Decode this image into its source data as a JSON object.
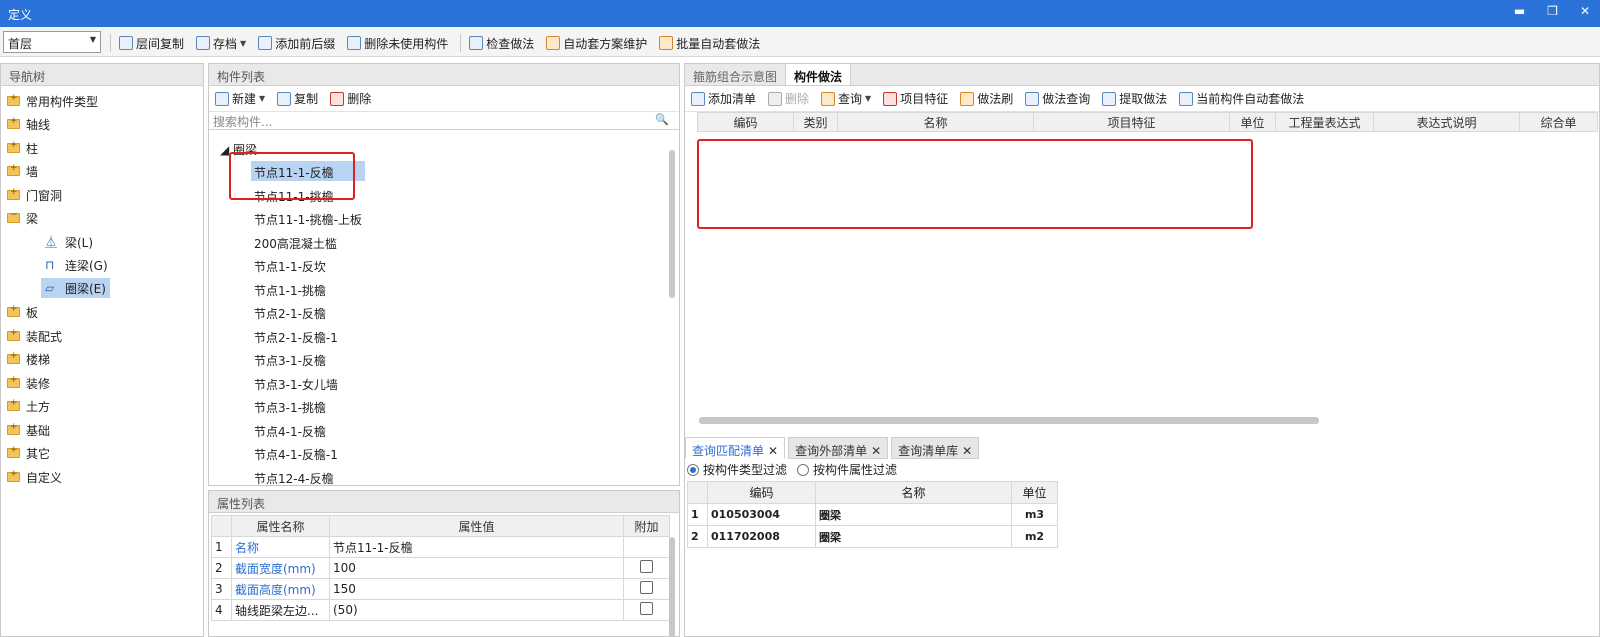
{
  "window": {
    "title": "定义",
    "minimize": "▬",
    "restore": "❐",
    "close": "✕"
  },
  "toolbar": {
    "floor_value": "首层",
    "items": [
      "层间复制",
      "存档",
      "添加前后缀",
      "删除未使用构件",
      "检查做法",
      "自动套方案维护",
      "批量自动套做法"
    ]
  },
  "nav": {
    "title": "导航树",
    "items": [
      "常用构件类型",
      "轴线",
      "柱",
      "墙",
      "门窗洞",
      "梁",
      "板",
      "装配式",
      "楼梯",
      "装修",
      "土方",
      "基础",
      "其它",
      "自定义"
    ],
    "sub_items": [
      "梁(L)",
      "连梁(G)",
      "圈梁(E)"
    ]
  },
  "components": {
    "title": "构件列表",
    "toolbar": [
      "新建",
      "复制",
      "删除"
    ],
    "search_placeholder": "搜索构件...",
    "group": "圈梁",
    "items": [
      "节点11-1-反檐",
      "节点11-1-挑檐",
      "节点11-1-挑檐-上板",
      "200高混凝土槛",
      "节点1-1-反坎",
      "节点1-1-挑檐",
      "节点2-1-反檐",
      "节点2-1-反檐-1",
      "节点3-1-反檐",
      "节点3-1-女儿墙",
      "节点3-1-挑檐",
      "节点4-1-反檐",
      "节点4-1-反檐-1",
      "节点12-4-反檐"
    ]
  },
  "properties": {
    "title": "属性列表",
    "headers": [
      "属性名称",
      "属性值",
      "附加"
    ],
    "rows": [
      {
        "idx": "1",
        "name": "名称",
        "value": "节点11-1-反檐"
      },
      {
        "idx": "2",
        "name": "截面宽度(mm)",
        "value": "100"
      },
      {
        "idx": "3",
        "name": "截面高度(mm)",
        "value": "150"
      },
      {
        "idx": "4",
        "name": "轴线距梁左边...",
        "value": "(50)"
      }
    ]
  },
  "right": {
    "tabs": [
      "箍筋组合示意图",
      "构件做法"
    ],
    "toolbar": [
      "添加清单",
      "删除",
      "查询",
      "项目特征",
      "做法刷",
      "做法查询",
      "提取做法",
      "当前构件自动套做法"
    ],
    "grid_headers": [
      "编码",
      "类别",
      "名称",
      "项目特征",
      "单位",
      "工程量表达式",
      "表达式说明",
      "综合单"
    ]
  },
  "query": {
    "tabs": [
      "查询匹配清单",
      "查询外部清单",
      "查询清单库"
    ],
    "close_glyph": "✕",
    "filters": [
      "按构件类型过滤",
      "按构件属性过滤"
    ],
    "headers": [
      "编码",
      "名称",
      "单位"
    ],
    "rows": [
      {
        "idx": "1",
        "code": "010503004",
        "name": "圈梁",
        "unit": "m3"
      },
      {
        "idx": "2",
        "code": "011702008",
        "name": "圈梁",
        "unit": "m2"
      }
    ]
  }
}
